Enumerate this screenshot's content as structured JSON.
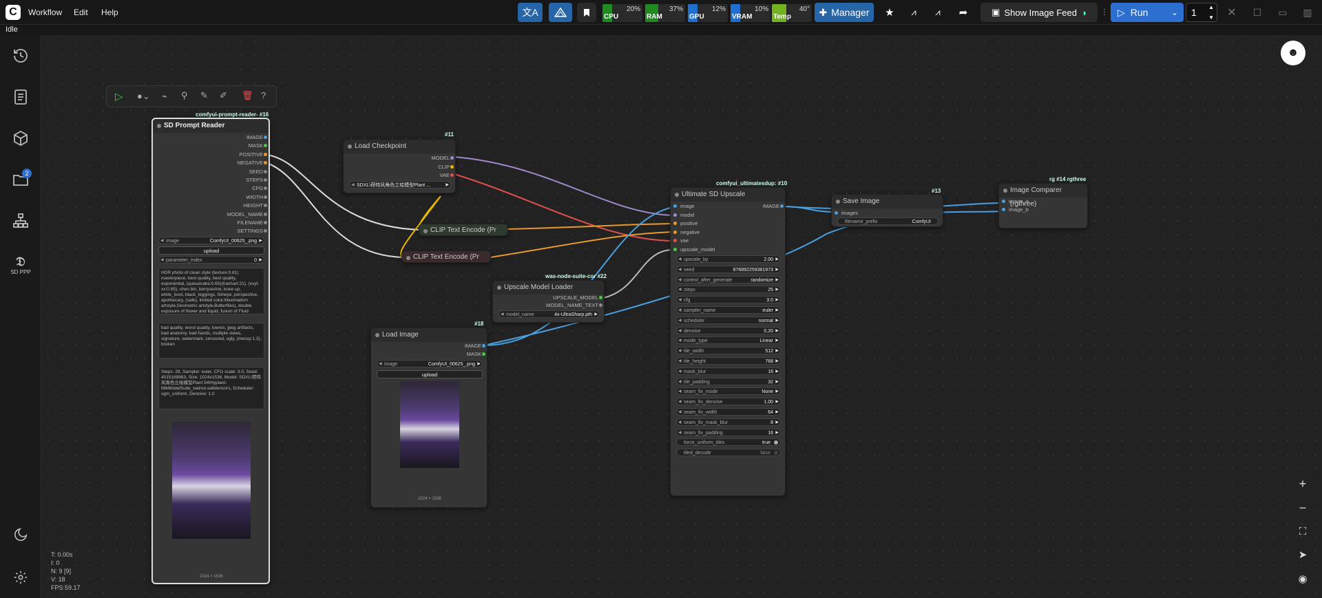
{
  "menu": {
    "logo": "C",
    "workflow": "Workflow",
    "edit": "Edit",
    "help": "Help"
  },
  "meters": [
    {
      "label": "CPU",
      "value": "20%",
      "color": "#1f8a1f",
      "level": 0.2
    },
    {
      "label": "RAM",
      "value": "37%",
      "color": "#1f8a1f",
      "level": 0.37
    },
    {
      "label": "GPU",
      "value": "12%",
      "color": "#1f6fd0",
      "level": 0.12
    },
    {
      "label": "VRAM",
      "value": "10%",
      "color": "#1f6fd0",
      "level": 0.1
    },
    {
      "label": "Temp",
      "value": "40°",
      "color": "#74b21f",
      "level": 0.4
    }
  ],
  "toolbar": {
    "manager": "Manager",
    "show_image_feed": "Show Image Feed",
    "run": "Run",
    "queue_count": "1"
  },
  "status": "Idle",
  "sidebar": {
    "badge": "2",
    "sdppp_label": "SD PPP"
  },
  "stats": {
    "t": "T: 0.00s",
    "i": "I: 0",
    "n": "N: 9 [9]",
    "v": "V: 18",
    "fps": "FPS:59.17"
  },
  "nodes": {
    "prompt_reader": {
      "badge": "comfyui-prompt-reader- #16",
      "title": "SD Prompt Reader",
      "outputs": [
        "IMAGE",
        "MASK",
        "POSITIVE",
        "NEGATIVE",
        "SEED",
        "STEPS",
        "CFG",
        "WIDTH",
        "HEIGHT",
        "MODEL_NAME",
        "FILENAME",
        "SETTINGS"
      ],
      "image_label": "image",
      "image_value": "ComfyUI_00625_.png",
      "upload": "upload",
      "param_label": "parameter_index",
      "param_value": "0",
      "positive_text": "HDR photo of clean style (texture:0.81) masterpiece, best quality, best quality, exponential, (queuecake:0.65)(train\\art:21), (xxyt-xx:0.65), chen bin, berryserine, knee up, white_boot, black_leggings, fisheye, perspective, apothecary, (safe), limited color,Maximalism artstyle,Geometric artstyle,Butterflies), double exposure of flower and liquid, fusion of Fluid virginia abstract art,naked,black and white paintsss, sketch, anime",
      "negative_text": "bad quality, worst quality, lowres, jpeg artifacts, bad anatomy, bad hands, multiple views, signature, watermark, censored, ugly, (messy:1.3), broken",
      "settings_text": "Steps: 28, Sampler: euler, CFG scale: 3.0, Seed: 4015169963, Size: 1024x1536, Model: SDXL\\荷特风角色立绘模型Plant 54\\Hyplant-MikModelSuite_walnut.safetensors, Scheduler: sgm_uniform, Denoise: 1.0",
      "caption": "1024 × 1536"
    },
    "load_checkpoint": {
      "badge": "#11",
      "title": "Load Checkpoint",
      "outputs": [
        "MODEL",
        "CLIP",
        "VAE"
      ],
      "ckpt": "SDXL\\荷特风角色立绘模型Plant ..."
    },
    "clip1": {
      "title": "CLIP Text Encode (Pr"
    },
    "clip2": {
      "title": "CLIP Text Encode (Pr"
    },
    "upscale_loader": {
      "badge": "was-node-suite-cor #22",
      "title": "Upscale Model Loader",
      "outputs": [
        "UPSCALE_MODEL",
        "MODEL_NAME_TEXT"
      ],
      "model_label": "model_name",
      "model_value": "4x-UltraSharp.pth"
    },
    "load_image": {
      "badge": "#18",
      "title": "Load Image",
      "outputs": [
        "IMAGE",
        "MASK"
      ],
      "image_label": "image",
      "image_value": "ComfyUI_00625_.png",
      "upload": "upload",
      "caption": "1024 × 1536"
    },
    "ultimate": {
      "badge": "comfyui_ultimatesdup: #10",
      "title": "Ultimate SD Upscale",
      "inputs": [
        "image",
        "model",
        "positive",
        "negative",
        "vae",
        "upscale_model"
      ],
      "output": "IMAGE",
      "widgets": [
        {
          "l": "upscale_by",
          "v": "2.00"
        },
        {
          "l": "seed",
          "v": "876892259381973"
        },
        {
          "l": "control_after_generate",
          "v": "randomize"
        },
        {
          "l": "steps",
          "v": "25"
        },
        {
          "l": "cfg",
          "v": "3.0"
        },
        {
          "l": "sampler_name",
          "v": "euler"
        },
        {
          "l": "scheduler",
          "v": "normal"
        },
        {
          "l": "denoise",
          "v": "0.20"
        },
        {
          "l": "mode_type",
          "v": "Linear"
        },
        {
          "l": "tile_width",
          "v": "512"
        },
        {
          "l": "tile_height",
          "v": "768"
        },
        {
          "l": "mask_blur",
          "v": "16"
        },
        {
          "l": "tile_padding",
          "v": "32"
        },
        {
          "l": "seam_fix_mode",
          "v": "None"
        },
        {
          "l": "seam_fix_denoise",
          "v": "1.00"
        },
        {
          "l": "seam_fix_width",
          "v": "64"
        },
        {
          "l": "seam_fix_mask_blur",
          "v": "8"
        },
        {
          "l": "seam_fix_padding",
          "v": "16"
        }
      ],
      "toggles": [
        {
          "l": "force_uniform_tiles",
          "v": "true"
        },
        {
          "l": "tiled_decode",
          "v": "false"
        }
      ]
    },
    "save_image": {
      "badge": "#13",
      "title": "Save Image",
      "input": "images",
      "prefix_label": "filename_prefix",
      "prefix_value": "ComfyUI"
    },
    "comparer": {
      "badge": "rg #14 rgthree",
      "title": "Image Comparer (rgthree)",
      "inputs": [
        "image_a",
        "image_b"
      ]
    }
  },
  "colors": {
    "accent": "#1e88e5",
    "manager": "#2565a8",
    "run": "#2d6fd1",
    "link_model": "#a08ad0",
    "link_clip": "#e6b800",
    "link_vae": "#e05050",
    "link_cond": "#e89a30",
    "link_image": "#4aa0e0",
    "link_white": "#dddddd"
  }
}
